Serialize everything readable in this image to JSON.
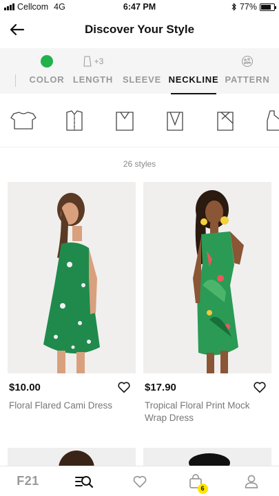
{
  "status_bar": {
    "carrier": "Cellcom",
    "network": "4G",
    "time": "6:47 PM",
    "battery": "77%",
    "battery_level": 0.77
  },
  "header": {
    "title": "Discover Your Style"
  },
  "filters": {
    "tabs": [
      {
        "label": "COLOR",
        "icon": "color-dot",
        "active": false
      },
      {
        "label": "LENGTH",
        "icon": "length-icon",
        "extra": "+3",
        "active": false
      },
      {
        "label": "SLEEVE",
        "icon": "",
        "active": false
      },
      {
        "label": "NECKLINE",
        "icon": "",
        "active": true
      },
      {
        "label": "PATTERN",
        "icon": "pattern-icon",
        "active": false
      }
    ],
    "selected_color": "#22b14c"
  },
  "necklines": [
    "crew-neck-icon",
    "collar-neck-icon",
    "v-neck-icon",
    "deep-v-neck-icon",
    "wrap-neck-icon",
    "halter-neck-icon"
  ],
  "results": {
    "count_label": "26 styles"
  },
  "products": [
    {
      "price": "$10.00",
      "name": "Floral Flared Cami Dress",
      "color": "#1f8a4c"
    },
    {
      "price": "$17.90",
      "name": "Tropical Floral Print Mock Wrap Dress",
      "color": "#2a9a55"
    }
  ],
  "tabbar": {
    "logo": "F21",
    "cart_count": "6",
    "items": [
      "home-logo",
      "discover-icon",
      "wishlist-icon",
      "bag-icon",
      "account-icon"
    ]
  },
  "colors": {
    "accent": "#111111",
    "muted": "#999999",
    "badge": "#ffe600",
    "filter_bg": "#f5f5f5"
  }
}
